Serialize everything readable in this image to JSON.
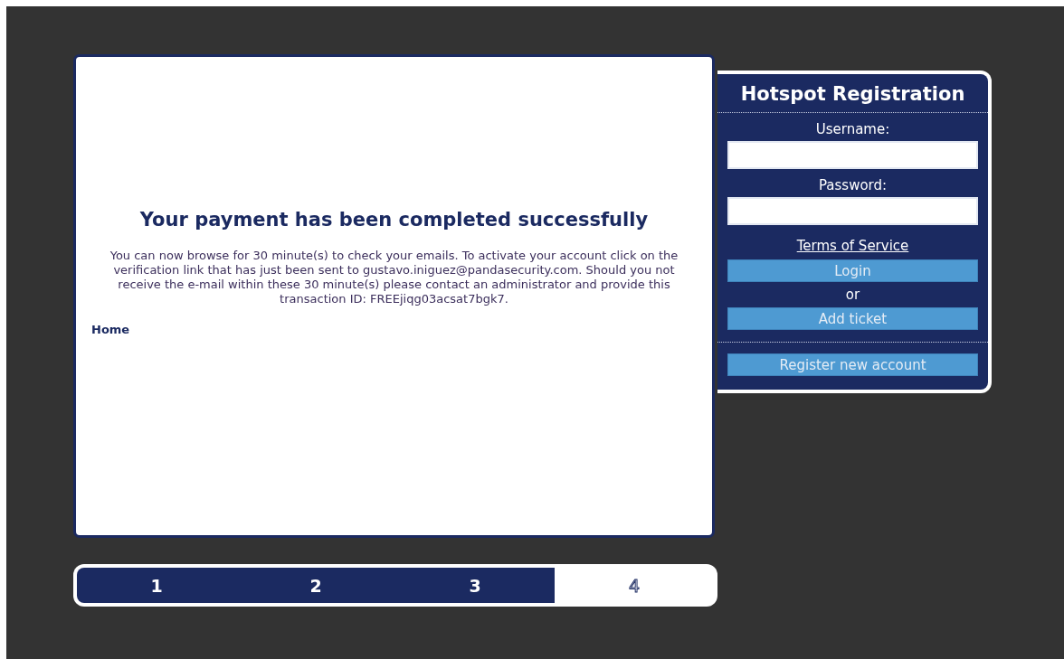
{
  "main": {
    "heading": "Your payment has been completed successfully",
    "message": "You can now browse for 30 minute(s) to check your emails. To activate your account click on the verification link that has just been sent to gustavo.iniguez@pandasecurity.com. Should you not receive the e-mail within these 30 minute(s) please contact an administrator and provide this transaction ID: FREEjiqg03acsat7bgk7.",
    "home_link": "Home"
  },
  "sidebar": {
    "title": "Hotspot Registration",
    "username_label": "Username:",
    "password_label": "Password:",
    "terms_link": "Terms of Service",
    "login_button": "Login",
    "or_text": "or",
    "add_ticket_button": "Add ticket",
    "register_button": "Register new account"
  },
  "steps": [
    {
      "label": "1",
      "completed": true
    },
    {
      "label": "2",
      "completed": true
    },
    {
      "label": "3",
      "completed": true
    },
    {
      "label": "4",
      "completed": false
    }
  ]
}
